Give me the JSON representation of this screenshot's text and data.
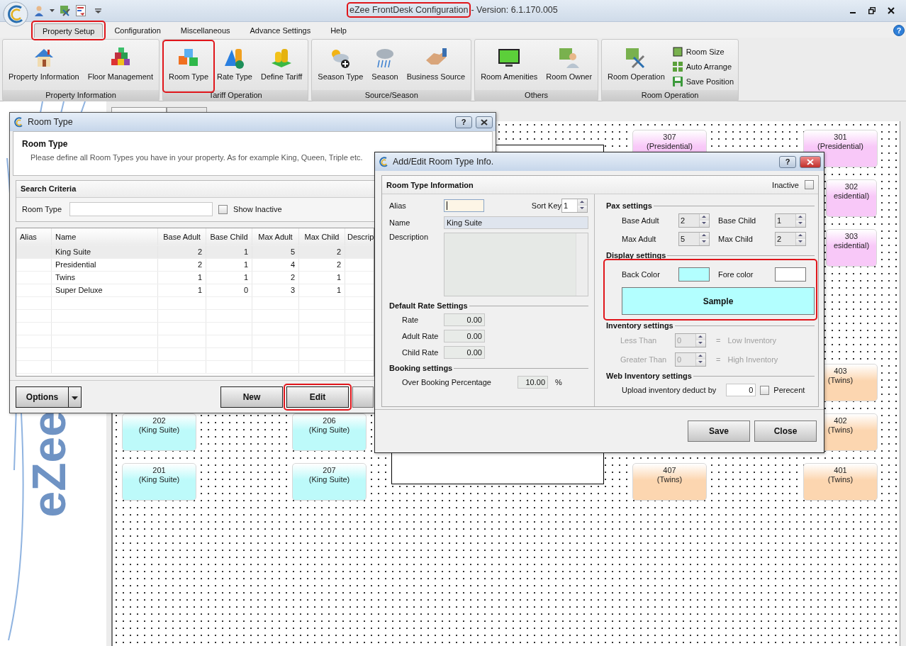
{
  "window": {
    "title": "eZee FrontDesk Configuration",
    "title_highlighted": true,
    "version": "- Version: 6.1.170.005"
  },
  "menu_tabs": [
    {
      "label": "Property Setup",
      "selected": true,
      "highlighted": true
    },
    {
      "label": "Configuration",
      "selected": false,
      "highlighted": false
    },
    {
      "label": "Miscellaneous",
      "selected": false,
      "highlighted": false
    },
    {
      "label": "Advance Settings",
      "selected": false,
      "highlighted": false
    },
    {
      "label": "Help",
      "selected": false,
      "highlighted": false
    }
  ],
  "help_button": "?",
  "ribbon_groups": [
    {
      "title": "Property Information",
      "items": [
        {
          "kind": "large",
          "label": "Property Information",
          "highlighted": false
        },
        {
          "kind": "large",
          "label": "Floor Management",
          "highlighted": false
        }
      ]
    },
    {
      "title": "Tariff Operation",
      "items": [
        {
          "kind": "large",
          "label": "Room Type",
          "highlighted": true
        },
        {
          "kind": "large",
          "label": "Rate Type",
          "highlighted": false
        },
        {
          "kind": "large",
          "label": "Define Tariff",
          "highlighted": false
        }
      ]
    },
    {
      "title": "Source/Season",
      "items": [
        {
          "kind": "large",
          "label": "Season Type",
          "highlighted": false
        },
        {
          "kind": "large",
          "label": "Season",
          "highlighted": false
        },
        {
          "kind": "large",
          "label": "Business Source",
          "highlighted": false
        }
      ]
    },
    {
      "title": "Others",
      "items": [
        {
          "kind": "large",
          "label": "Room Amenities",
          "highlighted": false
        },
        {
          "kind": "large",
          "label": "Room Owner",
          "highlighted": false
        }
      ]
    },
    {
      "title": "Room Operation",
      "items": [
        {
          "kind": "large",
          "label": "Room Operation",
          "highlighted": false
        },
        {
          "kind": "small",
          "label": "Room Size",
          "highlighted": false
        },
        {
          "kind": "small",
          "label": "Auto Arrange",
          "highlighted": false
        },
        {
          "kind": "small",
          "label": "Save Position",
          "highlighted": false
        }
      ]
    }
  ],
  "sidebar_logo": "eZee",
  "rooms": [
    {
      "number": "307",
      "type": "(Presidential)",
      "color": "#f8c8f8"
    },
    {
      "number": "301",
      "type": "(Presidential)",
      "color": "#f8c8f8"
    },
    {
      "number": "302",
      "type": "esidential)",
      "color": "#f8c8f8"
    },
    {
      "number": "303",
      "type": "esidential)",
      "color": "#f8c8f8"
    },
    {
      "number": "403",
      "type": "(Twins)",
      "color": "#fcd6b0"
    },
    {
      "number": "202",
      "type": "(King Suite)",
      "color": "#bdfafa"
    },
    {
      "number": "206",
      "type": "(King Suite)",
      "color": "#bdfafa"
    },
    {
      "number": "402",
      "type": "(Twins)",
      "color": "#fcd6b0"
    },
    {
      "number": "201",
      "type": "(King Suite)",
      "color": "#bdfafa"
    },
    {
      "number": "207",
      "type": "(King Suite)",
      "color": "#bdfafa"
    },
    {
      "number": "407",
      "type": "(Twins)",
      "color": "#fcd6b0"
    },
    {
      "number": "401",
      "type": "(Twins)",
      "color": "#fcd6b0"
    }
  ],
  "room_type_dialog": {
    "title": "Room Type",
    "help": "?",
    "heading": "Room Type",
    "description": "Please define all Room Types you have in your property. As for example King, Queen, Triple etc.",
    "search": {
      "title": "Search Criteria",
      "label": "Room Type",
      "show_inactive": {
        "label": "Show Inactive",
        "checked": false
      }
    },
    "columns": [
      "Alias",
      "Name",
      "Base Adult",
      "Base Child",
      "Max Adult",
      "Max Child",
      "Descrip"
    ],
    "rows": [
      {
        "name": "King Suite",
        "base_adult": "2",
        "base_child": "1",
        "max_adult": "5",
        "max_child": "2",
        "selected": true
      },
      {
        "name": "Presidential",
        "base_adult": "2",
        "base_child": "1",
        "max_adult": "4",
        "max_child": "2",
        "selected": false
      },
      {
        "name": "Twins",
        "base_adult": "1",
        "base_child": "1",
        "max_adult": "2",
        "max_child": "1",
        "selected": false
      },
      {
        "name": "Super Deluxe",
        "base_adult": "1",
        "base_child": "0",
        "max_adult": "3",
        "max_child": "1",
        "selected": false
      }
    ],
    "buttons": [
      {
        "label": "Options",
        "kind": "dropdown",
        "highlighted": false
      },
      {
        "label": "New",
        "kind": "plain",
        "highlighted": false
      },
      {
        "label": "Edit",
        "kind": "plain",
        "highlighted": true
      }
    ]
  },
  "edit_dialog": {
    "title": "Add/Edit Room Type Info.",
    "help": "?",
    "section_title": "Room Type Information",
    "inactive": {
      "label": "Inactive",
      "checked": false
    },
    "alias": {
      "label": "Alias",
      "focused": true
    },
    "sort_key": {
      "label": "Sort Key",
      "value": "1"
    },
    "name": {
      "label": "Name",
      "value": "King Suite"
    },
    "description": {
      "label": "Description"
    },
    "default_rates": {
      "title": "Default Rate Settings",
      "fields": [
        {
          "label": "Rate",
          "value": "0.00"
        },
        {
          "label": "Adult Rate",
          "value": "0.00"
        },
        {
          "label": "Child Rate",
          "value": "0.00"
        }
      ]
    },
    "booking": {
      "title": "Booking settings",
      "label": "Over Booking Percentage",
      "value": "10.00",
      "unit": "%"
    },
    "pax": {
      "title": "Pax settings",
      "fields": [
        {
          "label": "Base Adult",
          "value": "2"
        },
        {
          "label": "Base Child",
          "value": "1"
        },
        {
          "label": "Max Adult",
          "value": "5"
        },
        {
          "label": "Max Child",
          "value": "2"
        }
      ]
    },
    "display": {
      "title": "Display settings",
      "highlighted": true,
      "back_color_label": "Back Color",
      "fore_color_label": "Fore color",
      "sample": "Sample"
    },
    "inventory": {
      "title": "Inventory settings",
      "disabled": true,
      "rows": [
        {
          "label": "Less Than",
          "value": "0",
          "sign": "=",
          "result": "Low Inventory"
        },
        {
          "label": "Greater Than",
          "value": "0",
          "sign": "=",
          "result": "High Inventory"
        }
      ]
    },
    "web_inventory": {
      "title": "Web Inventory settings",
      "label": "Upload inventory deduct by",
      "value": "0",
      "percent": {
        "label": "Perecent",
        "checked": false
      }
    },
    "buttons": [
      {
        "label": "Save"
      },
      {
        "label": "Close"
      }
    ]
  }
}
